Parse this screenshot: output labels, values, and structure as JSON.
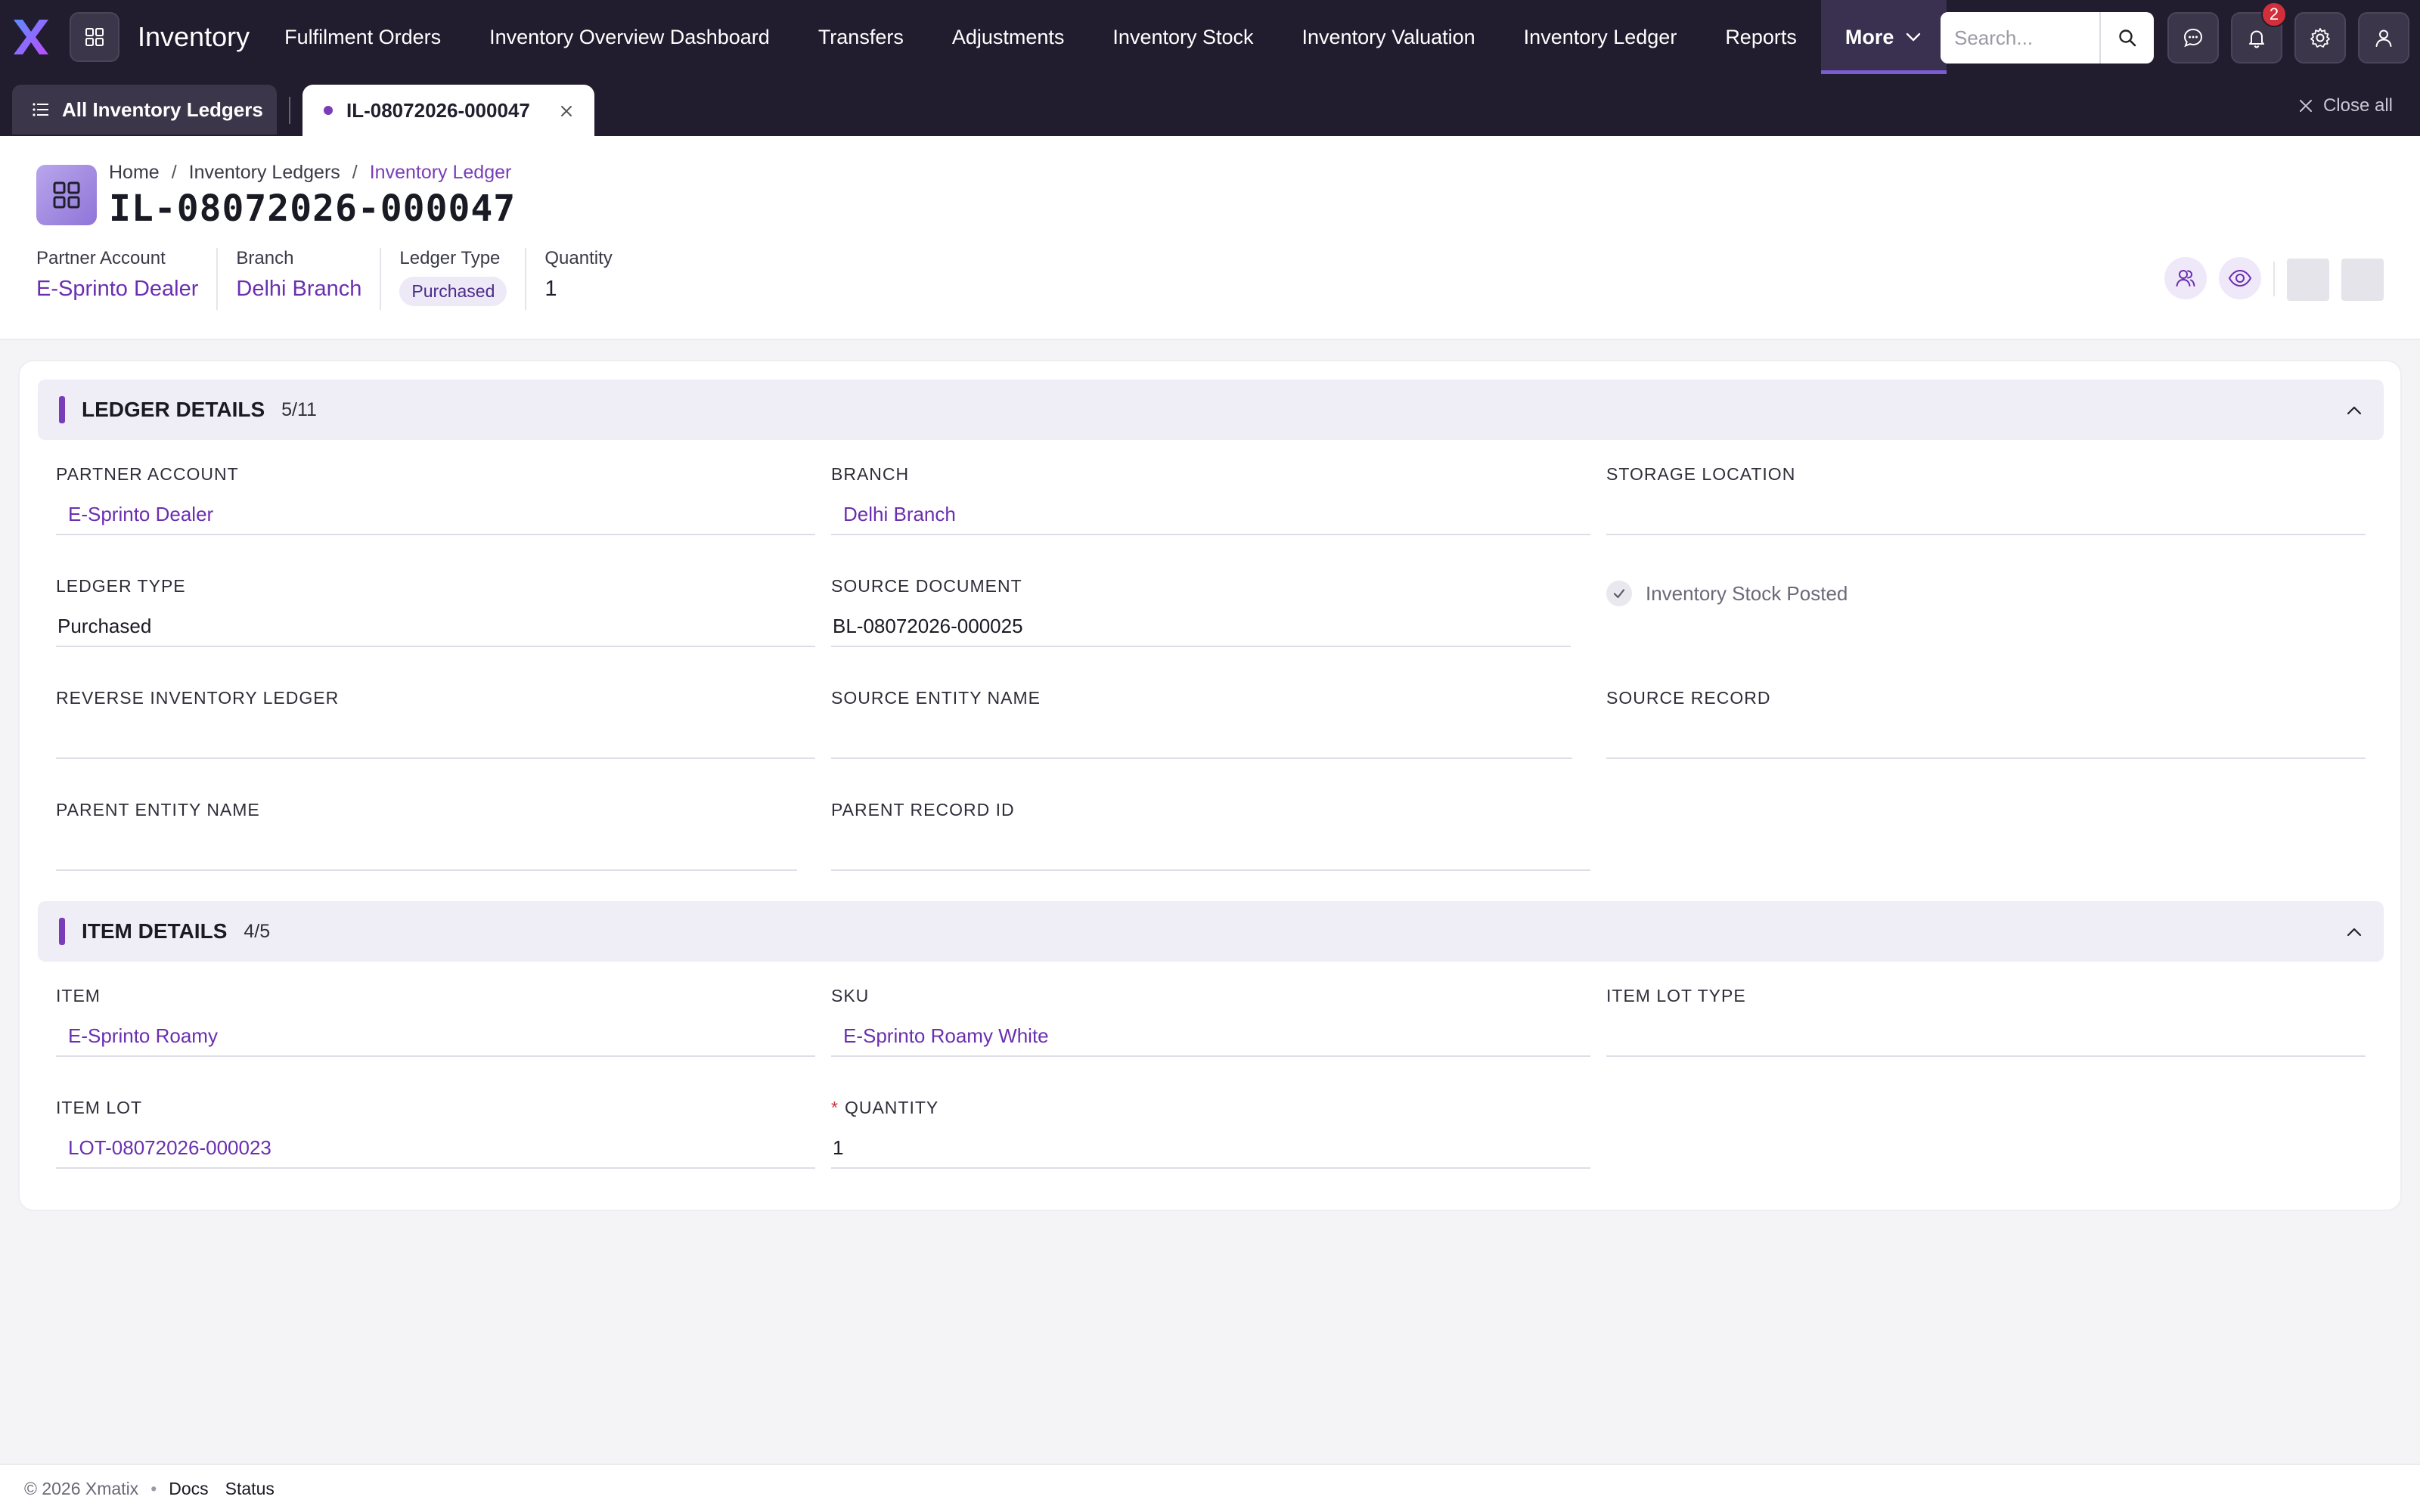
{
  "app": {
    "name": "Inventory",
    "logo_icon": "x-logo-icon",
    "apps_icon": "grid-icon"
  },
  "nav": {
    "items": [
      {
        "label": "Fulfilment Orders"
      },
      {
        "label": "Inventory Overview Dashboard"
      },
      {
        "label": "Transfers"
      },
      {
        "label": "Adjustments"
      },
      {
        "label": "Inventory Stock"
      },
      {
        "label": "Inventory Valuation"
      },
      {
        "label": "Inventory Ledger"
      },
      {
        "label": "Reports"
      }
    ],
    "more_label": "More",
    "search_placeholder": "Search...",
    "notification_count": "2"
  },
  "tabs": {
    "list_label": "All Inventory Ledgers",
    "active_label": "IL-08072026-000047",
    "close_all_label": "Close all"
  },
  "header": {
    "breadcrumb": [
      "Home",
      "Inventory Ledgers",
      "Inventory Ledger"
    ],
    "title": "IL-08072026-000047",
    "summary": [
      {
        "label": "Partner Account",
        "value": "E-Sprinto Dealer"
      },
      {
        "label": "Branch",
        "value": "Delhi Branch"
      },
      {
        "label": "Ledger Type",
        "value": "Purchased"
      },
      {
        "label": "Quantity",
        "value": "1"
      }
    ]
  },
  "ledger_details": {
    "title": "LEDGER DETAILS",
    "count": "5/11",
    "fields": {
      "partner_account": {
        "label": "PARTNER ACCOUNT",
        "value": "E-Sprinto Dealer"
      },
      "branch": {
        "label": "BRANCH",
        "value": "Delhi Branch"
      },
      "storage_location": {
        "label": "STORAGE LOCATION",
        "value": ""
      },
      "ledger_type": {
        "label": "LEDGER TYPE",
        "value": "Purchased"
      },
      "source_document": {
        "label": "SOURCE DOCUMENT",
        "value": "BL-08072026-000025"
      },
      "inventory_stock_posted": {
        "label": "Inventory Stock Posted",
        "checked": true
      },
      "reverse_inventory_ledger": {
        "label": "REVERSE INVENTORY LEDGER",
        "value": ""
      },
      "source_entity_name": {
        "label": "SOURCE ENTITY NAME",
        "value": ""
      },
      "source_record": {
        "label": "SOURCE RECORD",
        "value": ""
      },
      "parent_entity_name": {
        "label": "PARENT ENTITY NAME",
        "value": ""
      },
      "parent_record_id": {
        "label": "PARENT RECORD ID",
        "value": ""
      }
    }
  },
  "item_details": {
    "title": "ITEM DETAILS",
    "count": "4/5",
    "fields": {
      "item": {
        "label": "ITEM",
        "value": "E-Sprinto Roamy"
      },
      "sku": {
        "label": "SKU",
        "value": "E-Sprinto Roamy White"
      },
      "item_lot_type": {
        "label": "ITEM LOT TYPE",
        "value": ""
      },
      "item_lot": {
        "label": "ITEM LOT",
        "value": "LOT-08072026-000023"
      },
      "quantity": {
        "label": "QUANTITY",
        "value": "1",
        "required_marker": "*"
      }
    }
  },
  "footer": {
    "copyright": "© 2026 Xmatix",
    "separator": "•",
    "links": [
      "Docs",
      "Status"
    ]
  },
  "colors": {
    "nav_bg": "#211c2e",
    "accent": "#7a3db8",
    "link": "#6a2fb0",
    "required": "#d32f3a"
  }
}
